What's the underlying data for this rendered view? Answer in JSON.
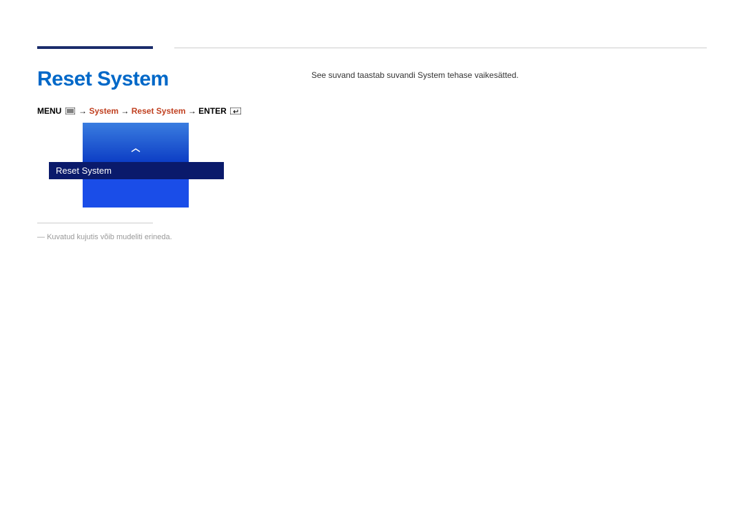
{
  "header": {
    "title": "Reset System"
  },
  "breadcrumb": {
    "menu_label": "MENU",
    "arrow": "→",
    "path1": "System",
    "path2": "Reset System",
    "enter_label": "ENTER"
  },
  "menu": {
    "selected_item": "Reset System"
  },
  "footnote": {
    "prefix": "―",
    "text": "Kuvatud kujutis võib mudeliti erineda."
  },
  "description": {
    "text": "See suvand taastab suvandi System tehase vaikesätted."
  }
}
